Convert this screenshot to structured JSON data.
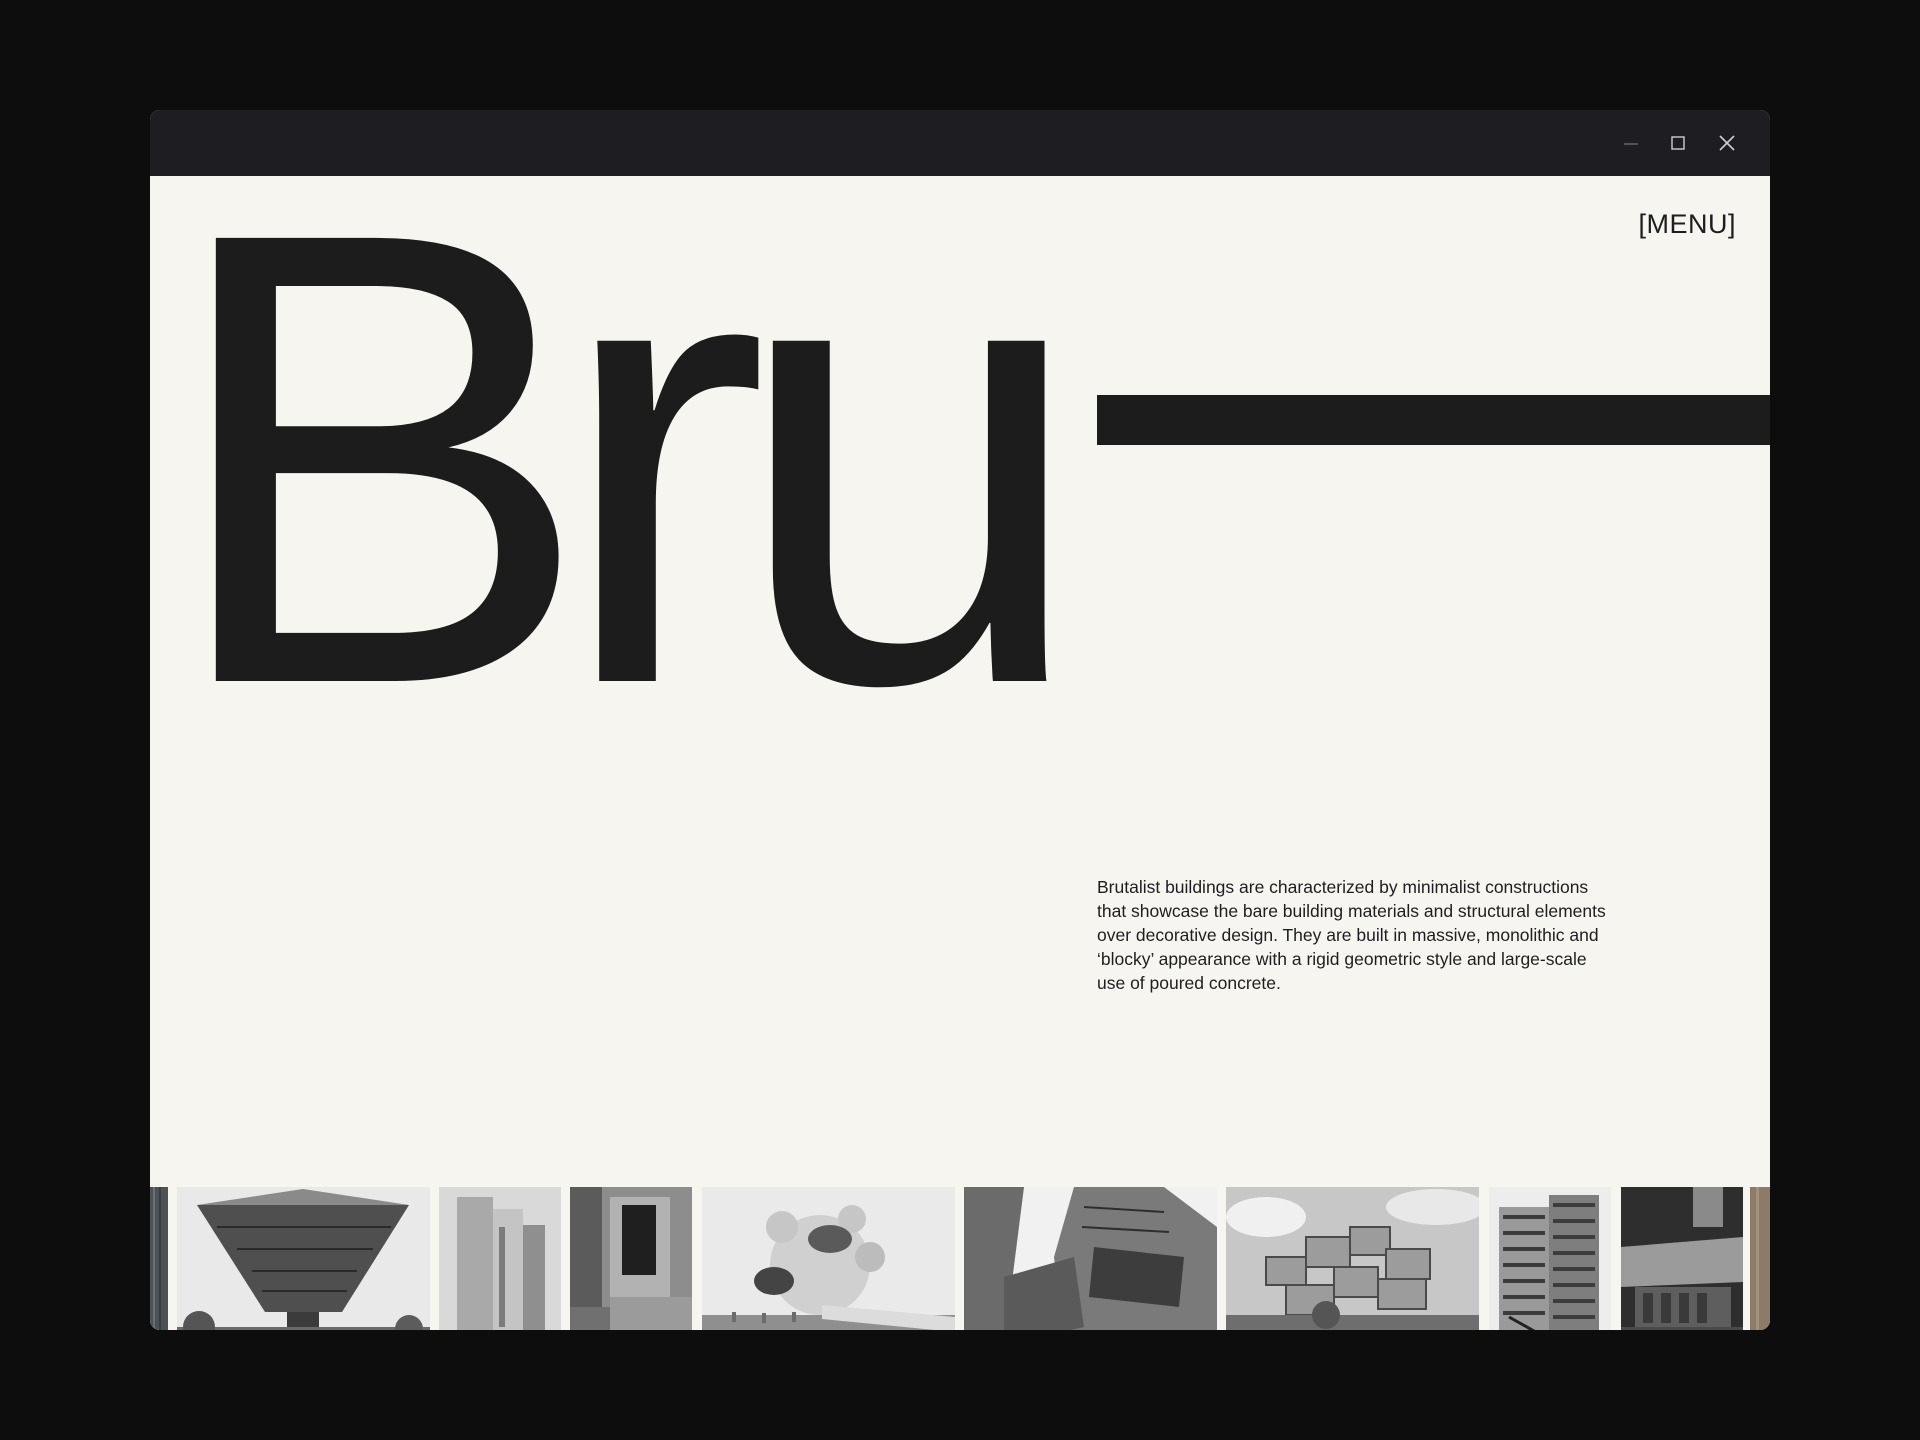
{
  "window": {
    "controls": [
      "minimize-icon",
      "maximize-icon",
      "close-icon"
    ]
  },
  "header": {
    "menu_label": "[MENU]"
  },
  "hero": {
    "word": "Bru"
  },
  "intro": {
    "text": "Brutalist buildings are characterized by minimalist constructions that showcase the bare building materials and structural elements over decorative design. They are built in massive, monolithic and ‘blocky’ appearance with a rigid geometric style and large-scale use of poured concrete."
  },
  "gallery": {
    "thumbnails": [
      "partial-building-photo",
      "inverted-pyramid-building-photo",
      "concrete-tower-photo",
      "concrete-facade-detail-photo",
      "futuro-capsule-building-photo",
      "angular-concrete-complex-photo",
      "stacked-blocks-housing-photo",
      "highrise-apartment-block-photo",
      "cantilevered-concrete-building-photo",
      "partial-brown-building-photo"
    ]
  },
  "colors": {
    "page_background": "#0d0d0e",
    "titlebar": "#1e1e22",
    "canvas": "#f7f5f0",
    "ink": "#1c1c1c"
  }
}
